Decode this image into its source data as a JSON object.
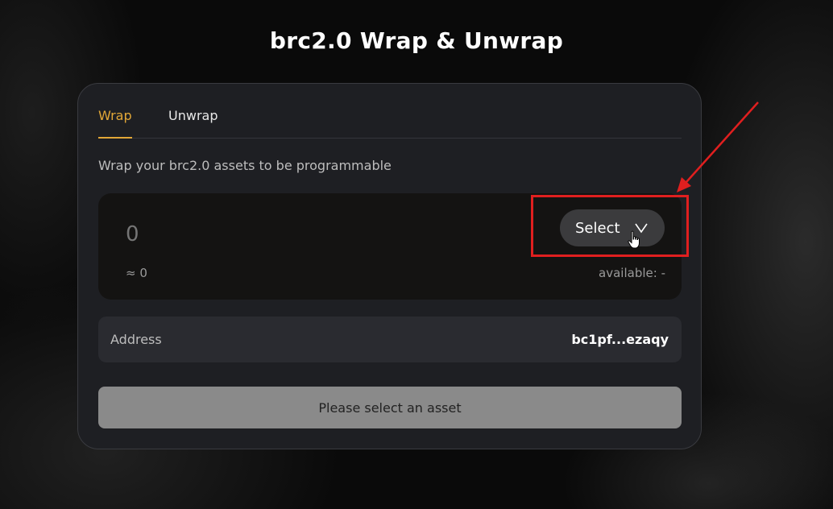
{
  "page": {
    "title": "brc2.0 Wrap & Unwrap"
  },
  "tabs": [
    {
      "label": "Wrap",
      "active": true
    },
    {
      "label": "Unwrap",
      "active": false
    }
  ],
  "description": "Wrap your brc2.0 assets to be programmable",
  "amount_input": {
    "placeholder": "0",
    "approx_value": "≈ 0",
    "available": "available: -",
    "select_label": "Select"
  },
  "address": {
    "label": "Address",
    "value": "bc1pf...ezaqy"
  },
  "submit": {
    "label": "Please select an asset"
  },
  "colors": {
    "accent": "#e2a737",
    "annotation": "#e01f1f",
    "card_bg": "#1e1f23",
    "button_disabled": "#8a8a8a"
  },
  "icons": [
    "chevron-down-icon",
    "hand-pointer-icon"
  ]
}
